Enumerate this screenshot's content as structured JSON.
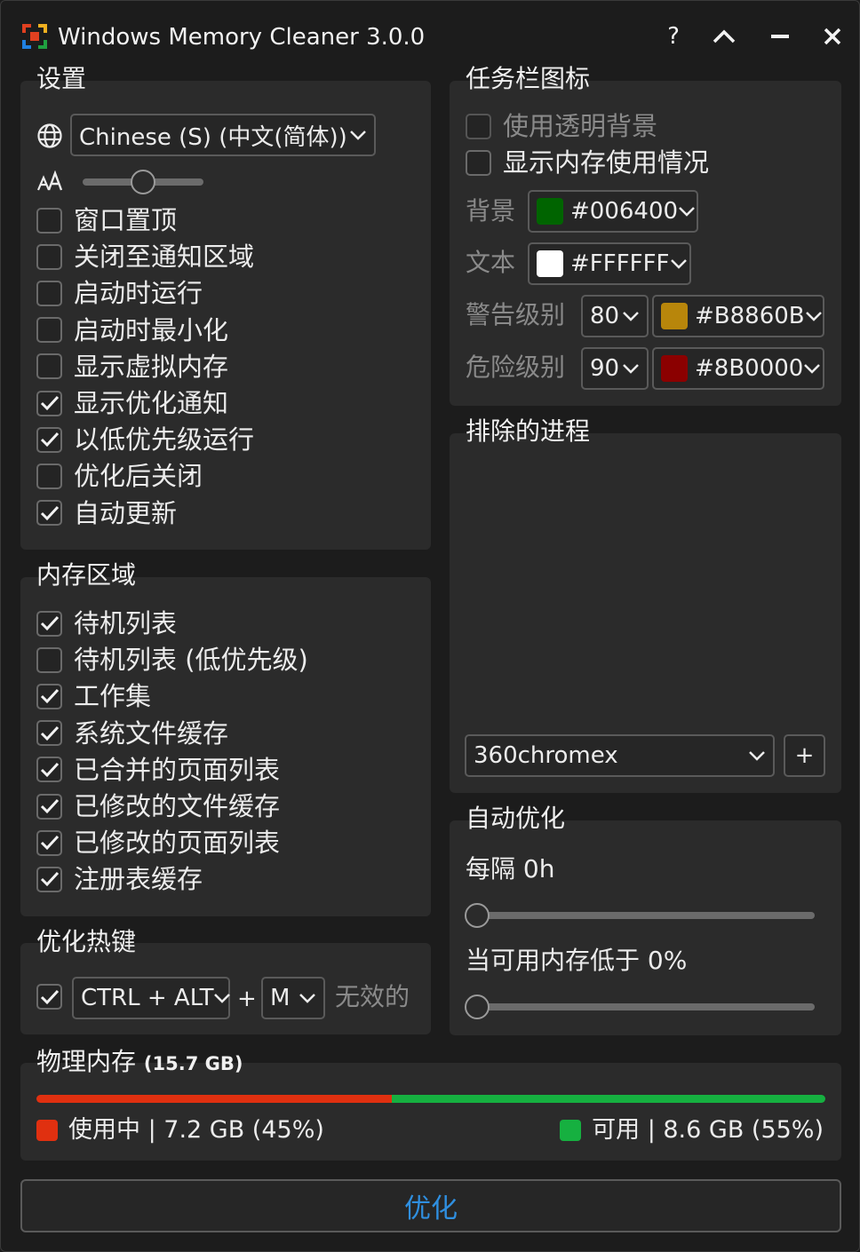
{
  "window": {
    "title": "Windows Memory Cleaner 3.0.0",
    "help_label": "?"
  },
  "settings": {
    "title": "设置",
    "language": "Chinese (S) (中文(简体))",
    "font_size_level": 0.5,
    "options": [
      {
        "label": "窗口置顶",
        "checked": false
      },
      {
        "label": "关闭至通知区域",
        "checked": false
      },
      {
        "label": "启动时运行",
        "checked": false
      },
      {
        "label": "启动时最小化",
        "checked": false
      },
      {
        "label": "显示虚拟内存",
        "checked": false
      },
      {
        "label": "显示优化通知",
        "checked": true
      },
      {
        "label": "以低优先级运行",
        "checked": true
      },
      {
        "label": "优化后关闭",
        "checked": false
      },
      {
        "label": "自动更新",
        "checked": true
      }
    ]
  },
  "memory_areas": {
    "title": "内存区域",
    "options": [
      {
        "label": "待机列表",
        "checked": true
      },
      {
        "label": "待机列表 (低优先级)",
        "checked": false
      },
      {
        "label": "工作集",
        "checked": true
      },
      {
        "label": "系统文件缓存",
        "checked": true
      },
      {
        "label": "已合并的页面列表",
        "checked": true
      },
      {
        "label": "已修改的文件缓存",
        "checked": true
      },
      {
        "label": "已修改的页面列表",
        "checked": true
      },
      {
        "label": "注册表缓存",
        "checked": true
      }
    ]
  },
  "hotkey": {
    "title": "优化热键",
    "enabled": true,
    "modifier": "CTRL + ALT",
    "plus": "+",
    "key": "M",
    "status": "无效的"
  },
  "tray_icon": {
    "title": "任务栏图标",
    "transparent_bg_label": "使用透明背景",
    "transparent_bg_checked": false,
    "show_usage_label": "显示内存使用情况",
    "show_usage_checked": false,
    "background_label": "背景",
    "background_color": "#006400",
    "text_label": "文本",
    "text_color": "#FFFFFF",
    "warning_label": "警告级别",
    "warning_level": "80",
    "warning_color": "#B8860B",
    "danger_label": "危险级别",
    "danger_level": "90",
    "danger_color": "#8B0000"
  },
  "excluded": {
    "title": "排除的进程",
    "process": "360chromex",
    "add_label": "+"
  },
  "auto_optimize": {
    "title": "自动优化",
    "interval_label": "每隔 0h",
    "interval_value": 0,
    "threshold_label": "当可用内存低于 0%",
    "threshold_value": 0
  },
  "physical_memory": {
    "title": "物理内存",
    "total": "(15.7 GB)",
    "used_fraction": 0.45,
    "used_label": "使用中 | 7.2 GB (45%)",
    "free_label": "可用 | 8.6 GB (55%)",
    "used_color": "#E03010",
    "free_color": "#16B040"
  },
  "optimize_button": "优化"
}
